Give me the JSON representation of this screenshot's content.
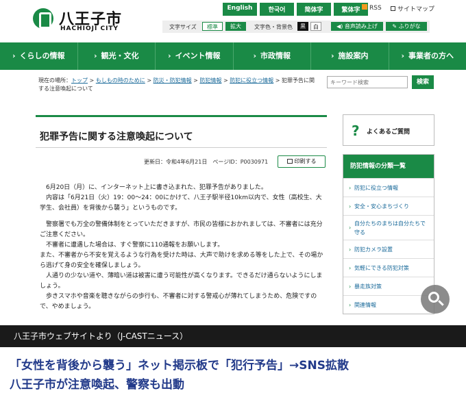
{
  "header": {
    "city_name_jp": "八王子市",
    "city_name_en": "HACHIOJI CITY",
    "languages": [
      "English",
      "한국어",
      "简体字",
      "繁体字"
    ],
    "rss_label": "RSS",
    "sitemap_label": "サイトマップ",
    "font_size_label": "文字サイズ",
    "font_size_standard": "標準",
    "font_size_large": "拡大",
    "color_label": "文字色・背景色",
    "color_black": "黒",
    "color_white": "白",
    "read_aloud": "音声読み上げ",
    "furigana": "ふりがな"
  },
  "nav": {
    "items": [
      "くらしの情報",
      "観光・文化",
      "イベント情報",
      "市政情報",
      "施設案内",
      "事業者の方へ"
    ]
  },
  "breadcrumb": {
    "prefix": "現在の場所：",
    "links": [
      "トップ",
      "もしもの時のために",
      "防災・防犯情報",
      "防犯情報",
      "防犯に役立つ情報"
    ],
    "separator": ">",
    "current": "犯罪予告に関する注意喚起について"
  },
  "search": {
    "placeholder": "キーワード検索",
    "button": "検索"
  },
  "article": {
    "title": "犯罪予告に関する注意喚起について",
    "updated": "更新日：令和4年6月21日",
    "page_id": "ページID：P0030971",
    "print": "印刷する",
    "paragraphs": [
      "6月20日（月）に、インターネット上に書き込まれた、犯罪予告がありました。",
      "内容は「6月21日（火）19：00～24：00にかけて、八王子駅半径10km以内で、女性（高校生、大学生、会社員）を背後から襲う」というものです。",
      "警察署でも万全の警備体制をとっていただきますが、市民の皆様におかれましては、不審者には充分ご注意ください。",
      "不審者に遭遇した場合は、すぐ警察に110通報をお願いします。",
      "また、不審者から不安を覚えるような行為を受けた時は、大声で助けを求める等をした上で、その場から逃げて身の安全を確保しましょう。",
      "人通りの少ない道や、薄暗い道は被害に遭う可能性が高くなります。できるだけ通らないようにしましょう。",
      "歩きスマホや音楽を聴きながらの歩行も、不審者に対する警戒心が薄れてしまうため、危険ですので、やめましょう。"
    ]
  },
  "sidebar": {
    "faq": "よくあるご質問",
    "category_title": "防犯情報の分類一覧",
    "categories": [
      "防犯に役立つ情報",
      "安全・安心まちづくり",
      "自分たちのまちは自分たちで守る",
      "防犯カメラ設置",
      "気軽にできる防犯対策",
      "暴走族対策",
      "関連情報"
    ]
  },
  "caption": "八王子市ウェブサイトより（J-CASTニュース）",
  "headline": {
    "line1": "「女性を背後から襲う」ネット掲示板で「犯行予告」→SNS拡散",
    "line2": "八王子市が注意喚起、警察も出動"
  }
}
